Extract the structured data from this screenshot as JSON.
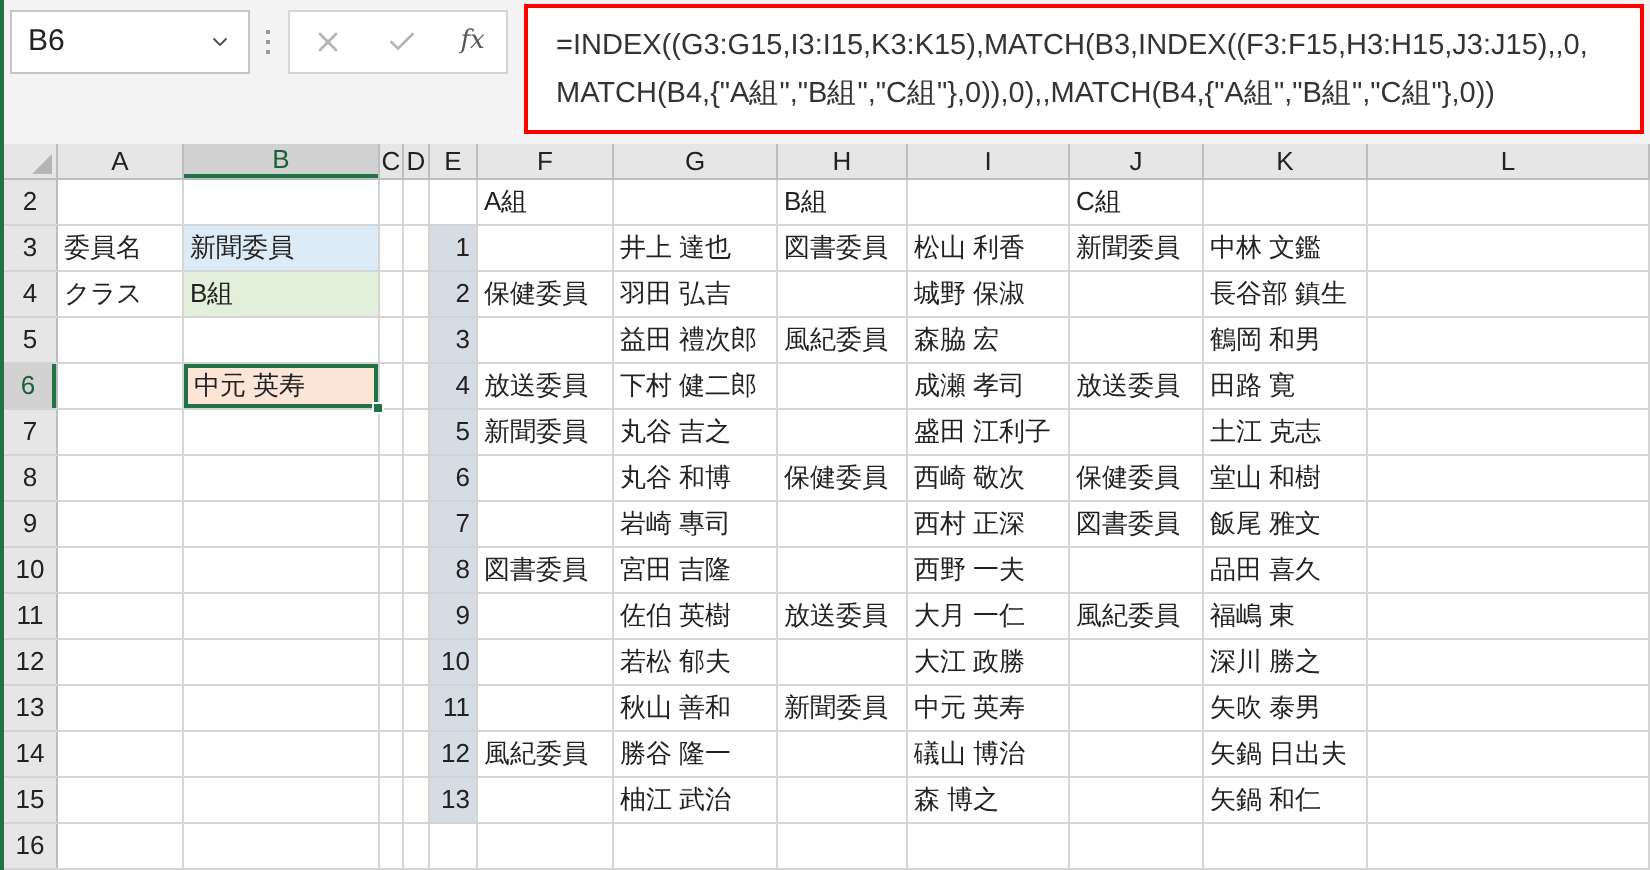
{
  "name_box": {
    "value": "B6"
  },
  "formula_bar": {
    "fx_label": "fx",
    "formula_lines": [
      "=INDEX((G3:G15,I3:I15,K3:K15),MATCH(B3,INDEX((F3:F15,H3:H15,J3:J15),,0,",
      "MATCH(B4,{\"A組\",\"B組\",\"C組\"},0)),0),,MATCH(B4,{\"A組\",\"B組\",\"C組\"},0))"
    ]
  },
  "columns": [
    {
      "letter": "A",
      "selected": false
    },
    {
      "letter": "B",
      "selected": true
    },
    {
      "letter": "C",
      "selected": false
    },
    {
      "letter": "D",
      "selected": false
    },
    {
      "letter": "E",
      "selected": false
    },
    {
      "letter": "F",
      "selected": false
    },
    {
      "letter": "G",
      "selected": false
    },
    {
      "letter": "H",
      "selected": false
    },
    {
      "letter": "I",
      "selected": false
    },
    {
      "letter": "J",
      "selected": false
    },
    {
      "letter": "K",
      "selected": false
    },
    {
      "letter": "L",
      "selected": false
    }
  ],
  "rows": [
    {
      "number": "2",
      "selected": false,
      "cells": {
        "col_f": {
          "text": "A組"
        },
        "col_h": {
          "text": "B組"
        },
        "col_j": {
          "text": "C組"
        }
      }
    },
    {
      "number": "3",
      "selected": false,
      "cells": {
        "col_a": {
          "text": "委員名"
        },
        "col_b": {
          "text": "新聞委員",
          "color": "#ddebf7"
        },
        "col_e": {
          "text": "1",
          "color": "#d6dce4"
        },
        "col_g": {
          "text": "井上 達也"
        },
        "col_h": {
          "text": "図書委員"
        },
        "col_i": {
          "text": "松山 利香"
        },
        "col_j": {
          "text": "新聞委員"
        },
        "col_k": {
          "text": "中林 文鑑"
        }
      }
    },
    {
      "number": "4",
      "selected": false,
      "cells": {
        "col_a": {
          "text": "クラス"
        },
        "col_b": {
          "text": "B組",
          "color": "#e2efda"
        },
        "col_e": {
          "text": "2",
          "color": "#d6dce4"
        },
        "col_f": {
          "text": "保健委員"
        },
        "col_g": {
          "text": "羽田 弘吉"
        },
        "col_i": {
          "text": "城野 保淑"
        },
        "col_k": {
          "text": "長谷部 鎮生"
        }
      }
    },
    {
      "number": "5",
      "selected": false,
      "cells": {
        "col_e": {
          "text": "3",
          "color": "#d6dce4"
        },
        "col_g": {
          "text": "益田 禮次郎"
        },
        "col_h": {
          "text": "風紀委員"
        },
        "col_i": {
          "text": "森脇 宏"
        },
        "col_k": {
          "text": "鶴岡 和男"
        }
      }
    },
    {
      "number": "6",
      "selected": true,
      "cells": {
        "col_b": {
          "text": "中元 英寿",
          "color": "#fce4d6"
        },
        "col_e": {
          "text": "4",
          "color": "#d6dce4"
        },
        "col_f": {
          "text": "放送委員"
        },
        "col_g": {
          "text": "下村 健二郎"
        },
        "col_i": {
          "text": "成瀬 孝司"
        },
        "col_j": {
          "text": "放送委員"
        },
        "col_k": {
          "text": "田路 寛"
        }
      }
    },
    {
      "number": "7",
      "selected": false,
      "cells": {
        "col_e": {
          "text": "5",
          "color": "#d6dce4"
        },
        "col_f": {
          "text": "新聞委員"
        },
        "col_g": {
          "text": "丸谷 吉之"
        },
        "col_i": {
          "text": "盛田 江利子"
        },
        "col_k": {
          "text": "土江 克志"
        }
      }
    },
    {
      "number": "8",
      "selected": false,
      "cells": {
        "col_e": {
          "text": "6",
          "color": "#d6dce4"
        },
        "col_g": {
          "text": "丸谷 和博"
        },
        "col_h": {
          "text": "保健委員"
        },
        "col_i": {
          "text": "西崎 敬次"
        },
        "col_j": {
          "text": "保健委員"
        },
        "col_k": {
          "text": "堂山 和樹"
        }
      }
    },
    {
      "number": "9",
      "selected": false,
      "cells": {
        "col_e": {
          "text": "7",
          "color": "#d6dce4"
        },
        "col_g": {
          "text": "岩崎 專司"
        },
        "col_i": {
          "text": "西村 正深"
        },
        "col_j": {
          "text": "図書委員"
        },
        "col_k": {
          "text": "飯尾 雅文"
        }
      }
    },
    {
      "number": "10",
      "selected": false,
      "cells": {
        "col_e": {
          "text": "8",
          "color": "#d6dce4"
        },
        "col_f": {
          "text": "図書委員"
        },
        "col_g": {
          "text": "宮田 吉隆"
        },
        "col_i": {
          "text": "西野 一夫"
        },
        "col_k": {
          "text": "品田 喜久"
        }
      }
    },
    {
      "number": "11",
      "selected": false,
      "cells": {
        "col_e": {
          "text": "9",
          "color": "#d6dce4"
        },
        "col_g": {
          "text": "佐伯 英樹"
        },
        "col_h": {
          "text": "放送委員"
        },
        "col_i": {
          "text": "大月 一仁"
        },
        "col_j": {
          "text": "風紀委員"
        },
        "col_k": {
          "text": "福嶋 東"
        }
      }
    },
    {
      "number": "12",
      "selected": false,
      "cells": {
        "col_e": {
          "text": "10",
          "color": "#d6dce4"
        },
        "col_g": {
          "text": "若松 郁夫"
        },
        "col_i": {
          "text": "大江 政勝"
        },
        "col_k": {
          "text": "深川 勝之"
        }
      }
    },
    {
      "number": "13",
      "selected": false,
      "cells": {
        "col_e": {
          "text": "11",
          "color": "#d6dce4"
        },
        "col_g": {
          "text": "秋山 善和"
        },
        "col_h": {
          "text": "新聞委員"
        },
        "col_i": {
          "text": "中元 英寿"
        },
        "col_k": {
          "text": "矢吹 泰男"
        }
      }
    },
    {
      "number": "14",
      "selected": false,
      "cells": {
        "col_e": {
          "text": "12",
          "color": "#d6dce4"
        },
        "col_f": {
          "text": "風紀委員"
        },
        "col_g": {
          "text": "勝谷 隆一"
        },
        "col_i": {
          "text": "礒山 博治"
        },
        "col_k": {
          "text": "矢鍋 日出夫"
        }
      }
    },
    {
      "number": "15",
      "selected": false,
      "cells": {
        "col_e": {
          "text": "13",
          "color": "#d6dce4"
        },
        "col_g": {
          "text": "柚江 武治"
        },
        "col_i": {
          "text": "森 博之"
        },
        "col_k": {
          "text": "矢鍋 和仁"
        }
      }
    },
    {
      "number": "16",
      "selected": false,
      "cells": {}
    }
  ]
}
